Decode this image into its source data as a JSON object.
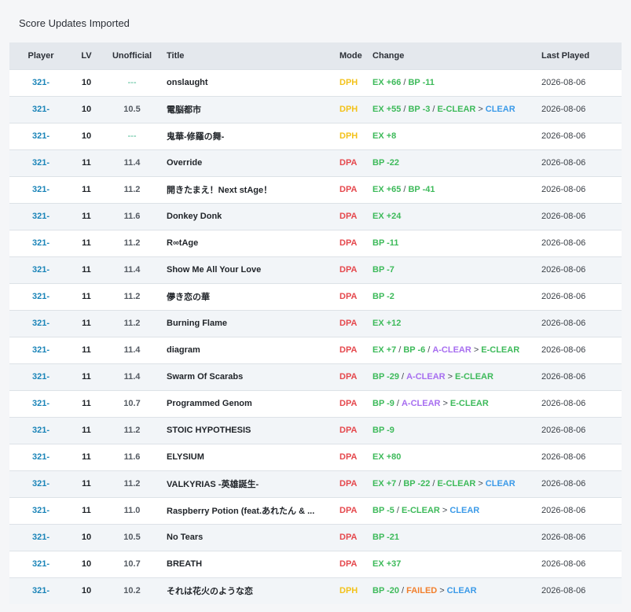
{
  "page": {
    "heading": "Score Updates Imported"
  },
  "colors": {
    "player": "#1a84b8",
    "mode_DPH": "#f3c21b",
    "mode_DPA": "#e5484d",
    "green": "#3dba5a",
    "blue": "#3b9ae8",
    "purple": "#a76ef0",
    "orange": "#f2802e"
  },
  "table": {
    "headers": {
      "player": "Player",
      "lv": "LV",
      "unofficial": "Unofficial",
      "title": "Title",
      "mode": "Mode",
      "change": "Change",
      "last_played": "Last Played"
    },
    "rows": [
      {
        "player": "321-",
        "lv": "10",
        "unofficial": "---",
        "title": "onslaught",
        "mode": "DPH",
        "change": [
          {
            "text": "EX +66",
            "color": "green"
          },
          {
            "sep": "/"
          },
          {
            "text": "BP -11",
            "color": "green"
          }
        ],
        "last_played": "2026-08-06"
      },
      {
        "player": "321-",
        "lv": "10",
        "unofficial": "10.5",
        "title": "電脳都市",
        "mode": "DPH",
        "change": [
          {
            "text": "EX +55",
            "color": "green"
          },
          {
            "sep": "/"
          },
          {
            "text": "BP -3",
            "color": "green"
          },
          {
            "sep": "/"
          },
          {
            "text": "E-CLEAR",
            "color": "green"
          },
          {
            "sep": ">"
          },
          {
            "text": "CLEAR",
            "color": "blue"
          }
        ],
        "last_played": "2026-08-06"
      },
      {
        "player": "321-",
        "lv": "10",
        "unofficial": "---",
        "title": "鬼華-修羅の舞-",
        "mode": "DPH",
        "change": [
          {
            "text": "EX +8",
            "color": "green"
          }
        ],
        "last_played": "2026-08-06"
      },
      {
        "player": "321-",
        "lv": "11",
        "unofficial": "11.4",
        "title": "Override",
        "mode": "DPA",
        "change": [
          {
            "text": "BP -22",
            "color": "green"
          }
        ],
        "last_played": "2026-08-06"
      },
      {
        "player": "321-",
        "lv": "11",
        "unofficial": "11.2",
        "title": "開きたまえ！Next stAge！",
        "mode": "DPA",
        "change": [
          {
            "text": "EX +65",
            "color": "green"
          },
          {
            "sep": "/"
          },
          {
            "text": "BP -41",
            "color": "green"
          }
        ],
        "last_played": "2026-08-06"
      },
      {
        "player": "321-",
        "lv": "11",
        "unofficial": "11.6",
        "title": "Donkey Donk",
        "mode": "DPA",
        "change": [
          {
            "text": "EX +24",
            "color": "green"
          }
        ],
        "last_played": "2026-08-06"
      },
      {
        "player": "321-",
        "lv": "11",
        "unofficial": "11.2",
        "title": "R∞tAge",
        "mode": "DPA",
        "change": [
          {
            "text": "BP -11",
            "color": "green"
          }
        ],
        "last_played": "2026-08-06"
      },
      {
        "player": "321-",
        "lv": "11",
        "unofficial": "11.4",
        "title": "Show Me All Your Love",
        "mode": "DPA",
        "change": [
          {
            "text": "BP -7",
            "color": "green"
          }
        ],
        "last_played": "2026-08-06"
      },
      {
        "player": "321-",
        "lv": "11",
        "unofficial": "11.2",
        "title": "儚き恋の華",
        "mode": "DPA",
        "change": [
          {
            "text": "BP -2",
            "color": "green"
          }
        ],
        "last_played": "2026-08-06"
      },
      {
        "player": "321-",
        "lv": "11",
        "unofficial": "11.2",
        "title": "Burning Flame",
        "mode": "DPA",
        "change": [
          {
            "text": "EX +12",
            "color": "green"
          }
        ],
        "last_played": "2026-08-06"
      },
      {
        "player": "321-",
        "lv": "11",
        "unofficial": "11.4",
        "title": "diagram",
        "mode": "DPA",
        "change": [
          {
            "text": "EX +7",
            "color": "green"
          },
          {
            "sep": "/"
          },
          {
            "text": "BP -6",
            "color": "green"
          },
          {
            "sep": "/"
          },
          {
            "text": "A-CLEAR",
            "color": "purple"
          },
          {
            "sep": ">"
          },
          {
            "text": "E-CLEAR",
            "color": "green"
          }
        ],
        "last_played": "2026-08-06"
      },
      {
        "player": "321-",
        "lv": "11",
        "unofficial": "11.4",
        "title": "Swarm Of Scarabs",
        "mode": "DPA",
        "change": [
          {
            "text": "BP -29",
            "color": "green"
          },
          {
            "sep": "/"
          },
          {
            "text": "A-CLEAR",
            "color": "purple"
          },
          {
            "sep": ">"
          },
          {
            "text": "E-CLEAR",
            "color": "green"
          }
        ],
        "last_played": "2026-08-06"
      },
      {
        "player": "321-",
        "lv": "11",
        "unofficial": "10.7",
        "title": "Programmed Genom",
        "mode": "DPA",
        "change": [
          {
            "text": "BP -9",
            "color": "green"
          },
          {
            "sep": "/"
          },
          {
            "text": "A-CLEAR",
            "color": "purple"
          },
          {
            "sep": ">"
          },
          {
            "text": "E-CLEAR",
            "color": "green"
          }
        ],
        "last_played": "2026-08-06"
      },
      {
        "player": "321-",
        "lv": "11",
        "unofficial": "11.2",
        "title": "STOIC HYPOTHESIS",
        "mode": "DPA",
        "change": [
          {
            "text": "BP -9",
            "color": "green"
          }
        ],
        "last_played": "2026-08-06"
      },
      {
        "player": "321-",
        "lv": "11",
        "unofficial": "11.6",
        "title": "ELYSIUM",
        "mode": "DPA",
        "change": [
          {
            "text": "EX +80",
            "color": "green"
          }
        ],
        "last_played": "2026-08-06"
      },
      {
        "player": "321-",
        "lv": "11",
        "unofficial": "11.2",
        "title": "VALKYRIAS -英雄誕生-",
        "mode": "DPA",
        "change": [
          {
            "text": "EX +7",
            "color": "green"
          },
          {
            "sep": "/"
          },
          {
            "text": "BP -22",
            "color": "green"
          },
          {
            "sep": "/"
          },
          {
            "text": "E-CLEAR",
            "color": "green"
          },
          {
            "sep": ">"
          },
          {
            "text": "CLEAR",
            "color": "blue"
          }
        ],
        "last_played": "2026-08-06"
      },
      {
        "player": "321-",
        "lv": "11",
        "unofficial": "11.0",
        "title": "Raspberry Potion (feat.あれたん & ...",
        "mode": "DPA",
        "change": [
          {
            "text": "BP -5",
            "color": "green"
          },
          {
            "sep": "/"
          },
          {
            "text": "E-CLEAR",
            "color": "green"
          },
          {
            "sep": ">"
          },
          {
            "text": "CLEAR",
            "color": "blue"
          }
        ],
        "last_played": "2026-08-06"
      },
      {
        "player": "321-",
        "lv": "10",
        "unofficial": "10.5",
        "title": "No Tears",
        "mode": "DPA",
        "change": [
          {
            "text": "BP -21",
            "color": "green"
          }
        ],
        "last_played": "2026-08-06"
      },
      {
        "player": "321-",
        "lv": "10",
        "unofficial": "10.7",
        "title": "BREATH",
        "mode": "DPA",
        "change": [
          {
            "text": "EX +37",
            "color": "green"
          }
        ],
        "last_played": "2026-08-06"
      },
      {
        "player": "321-",
        "lv": "10",
        "unofficial": "10.2",
        "title": "それは花火のような恋",
        "mode": "DPH",
        "change": [
          {
            "text": "BP -20",
            "color": "green"
          },
          {
            "sep": "/"
          },
          {
            "text": "FAILED",
            "color": "orange"
          },
          {
            "sep": ">"
          },
          {
            "text": "CLEAR",
            "color": "blue"
          }
        ],
        "last_played": "2026-08-06"
      }
    ]
  }
}
